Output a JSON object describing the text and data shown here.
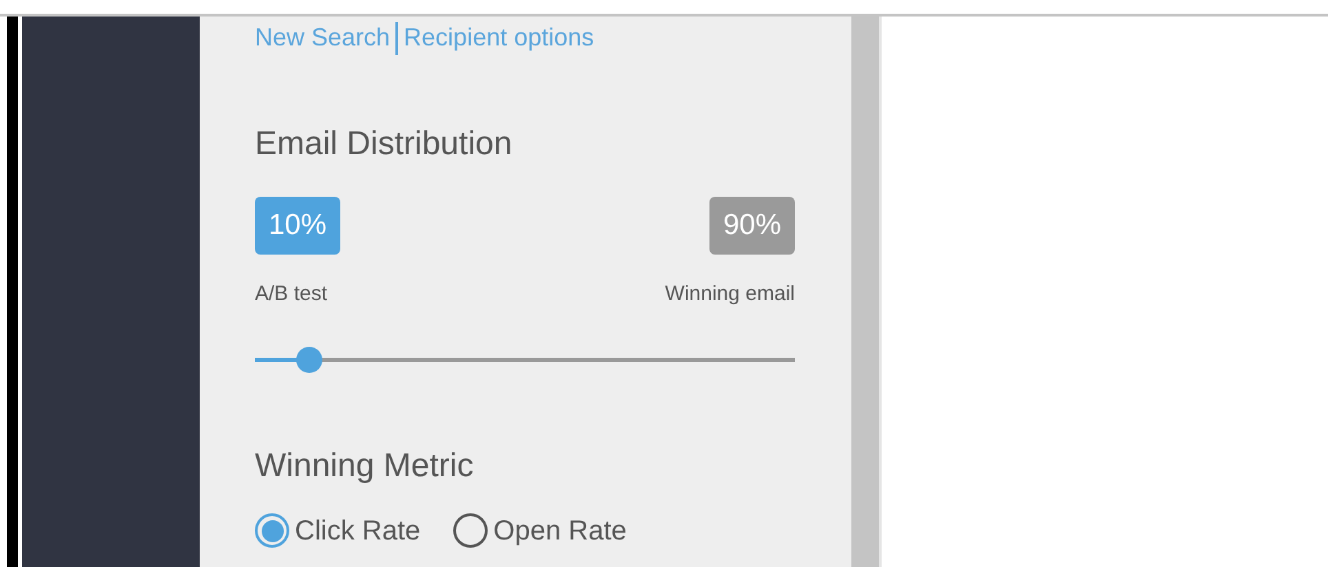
{
  "links": [
    {
      "label": "New Search"
    },
    {
      "label": "Recipient options"
    }
  ],
  "distribution": {
    "title": "Email Distribution",
    "left": {
      "value": "10%",
      "label": "A/B test"
    },
    "right": {
      "value": "90%",
      "label": "Winning email"
    },
    "level": 0.1
  },
  "metric": {
    "title": "Winning Metric",
    "options": [
      {
        "label": "Click Rate",
        "selected": true
      },
      {
        "label": "Open Rate",
        "selected": false
      }
    ]
  }
}
